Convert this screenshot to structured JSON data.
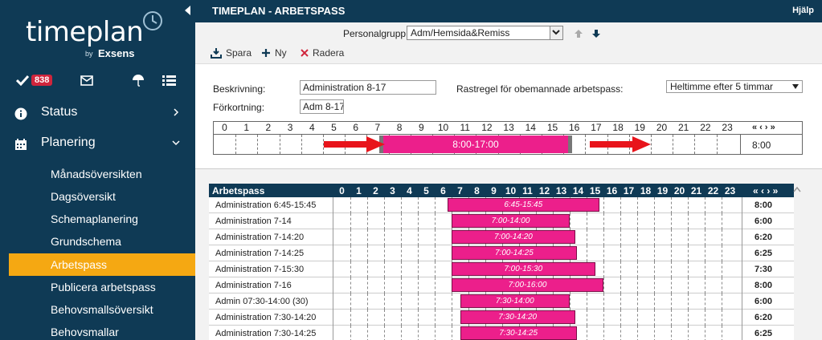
{
  "brand": {
    "logo": "timeplan",
    "by": "by",
    "company": "Exsens"
  },
  "iconbar": {
    "badge_count": "838",
    "icons": [
      "check-icon",
      "mail-icon",
      "umbrella-icon",
      "list-icon"
    ]
  },
  "nav": {
    "groups": [
      {
        "label": "Status",
        "icon": "info-icon"
      },
      {
        "label": "Planering",
        "icon": "calendar-icon"
      }
    ],
    "items": [
      {
        "label": "Månadsöversikten"
      },
      {
        "label": "Dagsöversikt"
      },
      {
        "label": "Schemaplanering"
      },
      {
        "label": "Grundschema"
      },
      {
        "label": "Arbetspass",
        "active": true
      },
      {
        "label": "Publicera arbetspass"
      },
      {
        "label": "Behovsmallsöversikt"
      },
      {
        "label": "Behovsmallar"
      }
    ]
  },
  "header": {
    "title": "TIMEPLAN - ARBETSPASS",
    "help": "Hjälp"
  },
  "personalgrupp": {
    "label": "Personalgrupp:",
    "value": "Adm/Hemsida&Remiss"
  },
  "actions": {
    "save": "Spara",
    "new": "Ny",
    "delete": "Radera"
  },
  "form": {
    "desc_label": "Beskrivning:",
    "desc_value": "Administration 8-17",
    "abbr_label": "Förkortning:",
    "abbr_value": "Adm 8-17",
    "rest_label": "Rastregel för obemannade arbetspass:",
    "rest_value": "Heltimme efter 5 timmar",
    "shift_label": "8:00-17:00",
    "shift_start": 8,
    "shift_end": 17,
    "total": "8:00",
    "nav_arrows": "« ‹ › »"
  },
  "hours": [
    "0",
    "1",
    "2",
    "3",
    "4",
    "5",
    "6",
    "7",
    "8",
    "9",
    "10",
    "11",
    "12",
    "13",
    "14",
    "15",
    "16",
    "17",
    "18",
    "19",
    "20",
    "21",
    "22",
    "23"
  ],
  "table": {
    "header": "Arbetspass",
    "nav_arrows": "« ‹ › »",
    "rows": [
      {
        "name": "Administration 6:45-15:45",
        "label": "6:45-15:45",
        "start": 6.75,
        "end": 15.75,
        "total": "8:00"
      },
      {
        "name": "Administration 7-14",
        "label": "7:00-14:00",
        "start": 7,
        "end": 14,
        "total": "6:00"
      },
      {
        "name": "Administration 7-14:20",
        "label": "7:00-14:20",
        "start": 7,
        "end": 14.33,
        "total": "6:20"
      },
      {
        "name": "Administration 7-14:25",
        "label": "7:00-14:25",
        "start": 7,
        "end": 14.42,
        "total": "6:25"
      },
      {
        "name": "Administration 7-15:30",
        "label": "7:00-15:30",
        "start": 7,
        "end": 15.5,
        "total": "7:30"
      },
      {
        "name": "Administration 7-16",
        "label": "7:00-16:00",
        "start": 7,
        "end": 16,
        "total": "8:00"
      },
      {
        "name": "Admin 07:30-14:00 (30)",
        "label": "7:30-14:00",
        "start": 7.5,
        "end": 14,
        "total": "6:00"
      },
      {
        "name": "Administration 7:30-14:20",
        "label": "7:30-14:20",
        "start": 7.5,
        "end": 14.33,
        "total": "6:20"
      },
      {
        "name": "Administration 7:30-14:25",
        "label": "7:30-14:25",
        "start": 7.5,
        "end": 14.42,
        "total": "6:25"
      }
    ]
  },
  "colors": {
    "navy": "#0f3a55",
    "active": "#f5a812",
    "shift": "#ec1f8b",
    "arrow": "#e8141b",
    "badge": "#d0253c"
  }
}
